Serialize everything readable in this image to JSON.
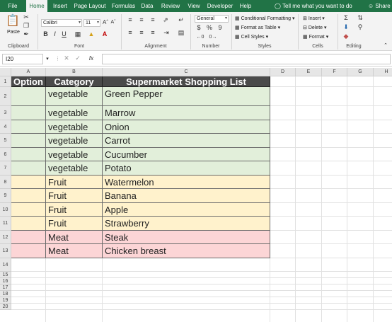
{
  "tabs": [
    "File",
    "Home",
    "Insert",
    "Page Layout",
    "Formulas",
    "Data",
    "Review",
    "View",
    "Developer",
    "Help"
  ],
  "active_tab": "Home",
  "tell_me": "Tell me what you want to do",
  "share": "Share",
  "ribbon": {
    "paste_label": "Paste",
    "clipboard_label": "Clipboard",
    "font_name": "Calibri",
    "font_size": "11",
    "font_label": "Font",
    "bold": "B",
    "italic": "I",
    "underline": "U",
    "alignment_label": "Alignment",
    "number_format": "General",
    "currency": "$",
    "percent": "%",
    "comma": "9",
    "number_label": "Number",
    "conditional_formatting": "Conditional Formatting",
    "format_as_table": "Format as Table",
    "cell_styles": "Cell Styles",
    "styles_label": "Styles",
    "insert": "Insert",
    "delete": "Delete",
    "format": "Format",
    "cells_label": "Cells",
    "editing_label": "Editing"
  },
  "formula_bar": {
    "name_box": "I20",
    "fx": "fx",
    "value": ""
  },
  "columns": [
    "A",
    "B",
    "C",
    "D",
    "E",
    "F",
    "G",
    "H"
  ],
  "rows": [
    "1",
    "2",
    "3",
    "4",
    "5",
    "6",
    "7",
    "8",
    "9",
    "10",
    "11",
    "12",
    "13",
    "14",
    "15",
    "16",
    "17",
    "18",
    "19",
    "20"
  ],
  "table": {
    "headers": [
      "Option",
      "Category",
      "Supermarket Shopping List"
    ],
    "rows": [
      {
        "category": "vegetable",
        "item": "Green Pepper",
        "group": "veg"
      },
      {
        "category": "vegetable",
        "item": "Marrow",
        "group": "veg"
      },
      {
        "category": "vegetable",
        "item": "Onion",
        "group": "veg"
      },
      {
        "category": "vegetable",
        "item": "Carrot",
        "group": "veg"
      },
      {
        "category": "vegetable",
        "item": "Cucumber",
        "group": "veg"
      },
      {
        "category": "vegetable",
        "item": "Potato",
        "group": "veg"
      },
      {
        "category": "Fruit",
        "item": "Watermelon",
        "group": "fruit"
      },
      {
        "category": "Fruit",
        "item": "Banana",
        "group": "fruit"
      },
      {
        "category": "Fruit",
        "item": "Apple",
        "group": "fruit"
      },
      {
        "category": "Fruit",
        "item": "Strawberry",
        "group": "fruit"
      },
      {
        "category": "Meat",
        "item": "Steak",
        "group": "meat"
      },
      {
        "category": "Meat",
        "item": "Chicken breast",
        "group": "meat"
      }
    ]
  },
  "colors": {
    "ribbon_green": "#217346",
    "header_fill": "#4a4a4a",
    "veg_fill": "#e2efda",
    "fruit_fill": "#fff2cc",
    "meat_fill": "#fcd5d6"
  }
}
